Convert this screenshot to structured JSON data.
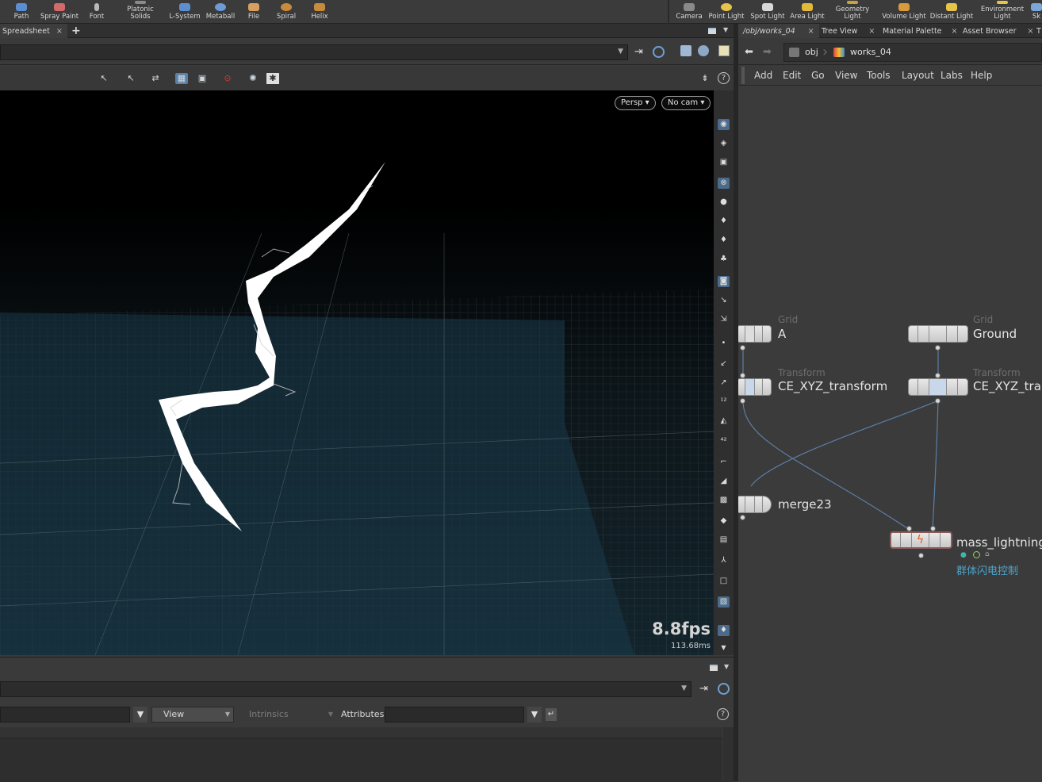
{
  "shelf": {
    "tools": [
      {
        "label": "Path",
        "icon": "path-icon"
      },
      {
        "label": "Spray Paint",
        "icon": "spray-paint-icon"
      },
      {
        "label": "Font",
        "icon": "font-icon"
      },
      {
        "label": "Platonic\nSolids",
        "icon": "platonic-solids-icon"
      },
      {
        "label": "L-System",
        "icon": "l-system-icon"
      },
      {
        "label": "Metaball",
        "icon": "metaball-icon"
      },
      {
        "label": "File",
        "icon": "file-icon"
      },
      {
        "label": "Spiral",
        "icon": "spiral-icon"
      },
      {
        "label": "Helix",
        "icon": "helix-icon"
      }
    ],
    "lights": [
      {
        "label": "Camera",
        "icon": "camera-icon"
      },
      {
        "label": "Point Light",
        "icon": "point-light-icon"
      },
      {
        "label": "Spot Light",
        "icon": "spot-light-icon"
      },
      {
        "label": "Area Light",
        "icon": "area-light-icon"
      },
      {
        "label": "Geometry\nLight",
        "icon": "geometry-light-icon"
      },
      {
        "label": "Volume Light",
        "icon": "volume-light-icon"
      },
      {
        "label": "Distant Light",
        "icon": "distant-light-icon"
      },
      {
        "label": "Environment\nLight",
        "icon": "environment-light-icon"
      },
      {
        "label": "Sk",
        "icon": "sky-light-icon"
      }
    ]
  },
  "left_tabs": {
    "spreadsheet": "Spreadsheet",
    "close": "×",
    "add": "+"
  },
  "right_tabs": [
    {
      "label": "/obj/works_04",
      "close": "×"
    },
    {
      "label": "Tree View",
      "close": "×"
    },
    {
      "label": "Material Palette",
      "close": "×"
    },
    {
      "label": "Asset Browser",
      "close": "×"
    },
    {
      "label": "T",
      "close": ""
    }
  ],
  "viewport": {
    "persp_label": "Persp ▾",
    "cam_label": "No cam ▾",
    "fps": "8.8fps",
    "frame_time": "113.68ms",
    "accent": "#5a7fa8"
  },
  "lower_panel": {
    "view_label": "View",
    "intrinsics_label": "Intrinsics",
    "attributes_label": "Attributes:"
  },
  "network": {
    "breadcrumb": [
      "obj",
      "works_04"
    ],
    "menu": [
      "Add",
      "Edit",
      "Go",
      "View",
      "Tools",
      "Layout",
      "Labs",
      "Help"
    ],
    "nodes": [
      {
        "type": "Grid",
        "name": "A"
      },
      {
        "type": "Grid",
        "name": "Ground"
      },
      {
        "type": "Transform",
        "name": "CE_XYZ_transform"
      },
      {
        "type": "Transform",
        "name": "CE_XYZ_tran"
      },
      {
        "type": "",
        "name": "merge23"
      },
      {
        "type": "",
        "name": "mass_lightning",
        "comment": "群体闪电控制",
        "comment_color": "#4da3c9"
      }
    ]
  }
}
